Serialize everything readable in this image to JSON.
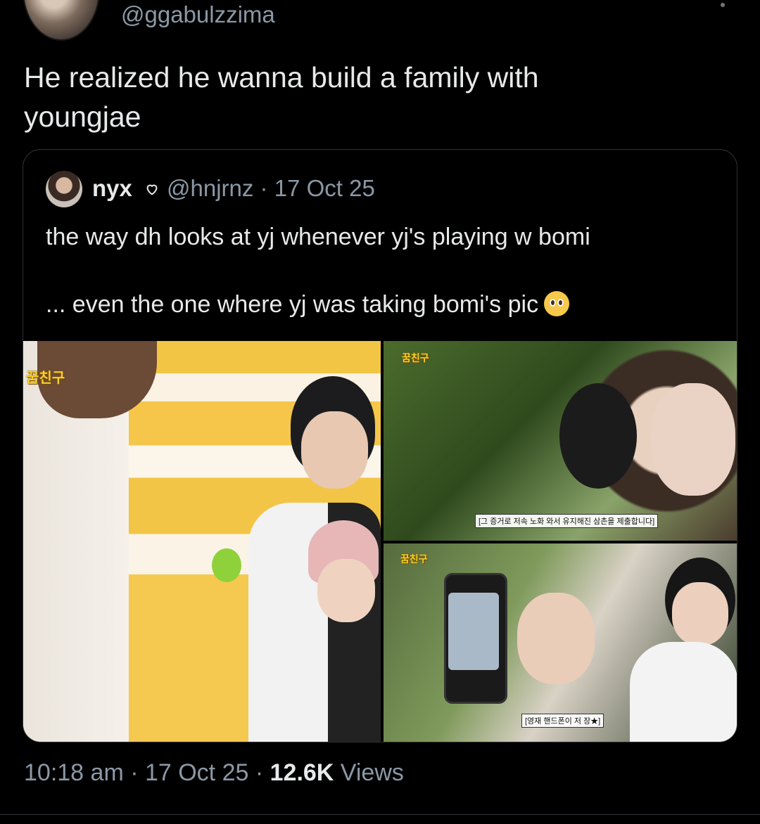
{
  "author": {
    "handle": "@ggabulzzima"
  },
  "tweet": {
    "text": "He realized he wanna build a family with\nyoungjae"
  },
  "quoted": {
    "name": "nyx",
    "handle_line": "@hnjrnz · 17 Oct 25",
    "text_line1": "the way dh looks at yj whenever yj's playing w bomi",
    "text_line2": "... even the one where yj was taking bomi's pic",
    "emoji": "pleading-face-emoji",
    "media": {
      "left_logo": "꿈친구",
      "tr_logo": "꿈친구",
      "br_logo": "꿈친구",
      "tr_subtitle": "[그 증거로 저속 노화 와서 유지해진 삼촌을 제출합니다]",
      "br_subtitle": "[영재 핸드폰이 저 장★]"
    }
  },
  "footer": {
    "time_date": "10:18 am · 17 Oct 25 · ",
    "views_count": "12.6K",
    "views_label": " Views"
  },
  "colors": {
    "background": "#000000",
    "text": "#e7e9ea",
    "secondary": "#8b98a5",
    "border": "#2f3336"
  }
}
